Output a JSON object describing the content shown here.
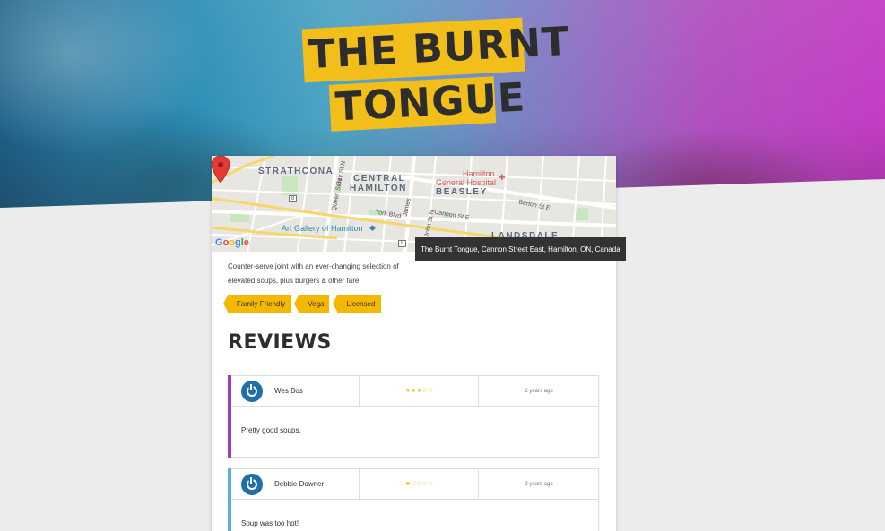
{
  "store": {
    "title_line1": "THE BURNT",
    "title_line2": "TONGUE",
    "description": "Counter-serve joint with an ever-changing selection of elevated soups, plus burgers & other fare.",
    "tags": [
      "Family Friendly",
      "Vega",
      "Licensed"
    ],
    "map": {
      "tooltip": "The Burnt Tongue, Cannon Street East, Hamilton, ON, Canada",
      "labels": {
        "strathcona": "STRATHCONA",
        "central": "CENTRAL",
        "hamilton": "HAMILTON",
        "beasley": "BEASLEY",
        "landsdale": "LANDSDALE",
        "hospital1": "Hamilton",
        "hospital2": "General Hospital",
        "gallery": "Art Gallery of Hamilton",
        "york": "York Blvd",
        "queen": "Queen St N",
        "bay": "Bay St N",
        "james": "James",
        "john": "John St N",
        "cannon": "Cannon St E",
        "barton": "Barton St E",
        "shield1": "8",
        "shield2": "8"
      },
      "google": [
        "G",
        "o",
        "o",
        "g",
        "l",
        "e"
      ]
    }
  },
  "reviews": {
    "heading": "REVIEWS",
    "items": [
      {
        "author": "Wes Bos",
        "stars": "★★★☆☆",
        "rating": 3,
        "time": "2 years ago",
        "text": "Pretty good soups.",
        "accent": "#9b3fc1"
      },
      {
        "author": "Debbie Downer",
        "stars": "★☆☆☆☆",
        "rating": 1,
        "time": "2 years ago",
        "text": "Soup was too hot!",
        "accent": "#5ab0d6"
      }
    ]
  }
}
